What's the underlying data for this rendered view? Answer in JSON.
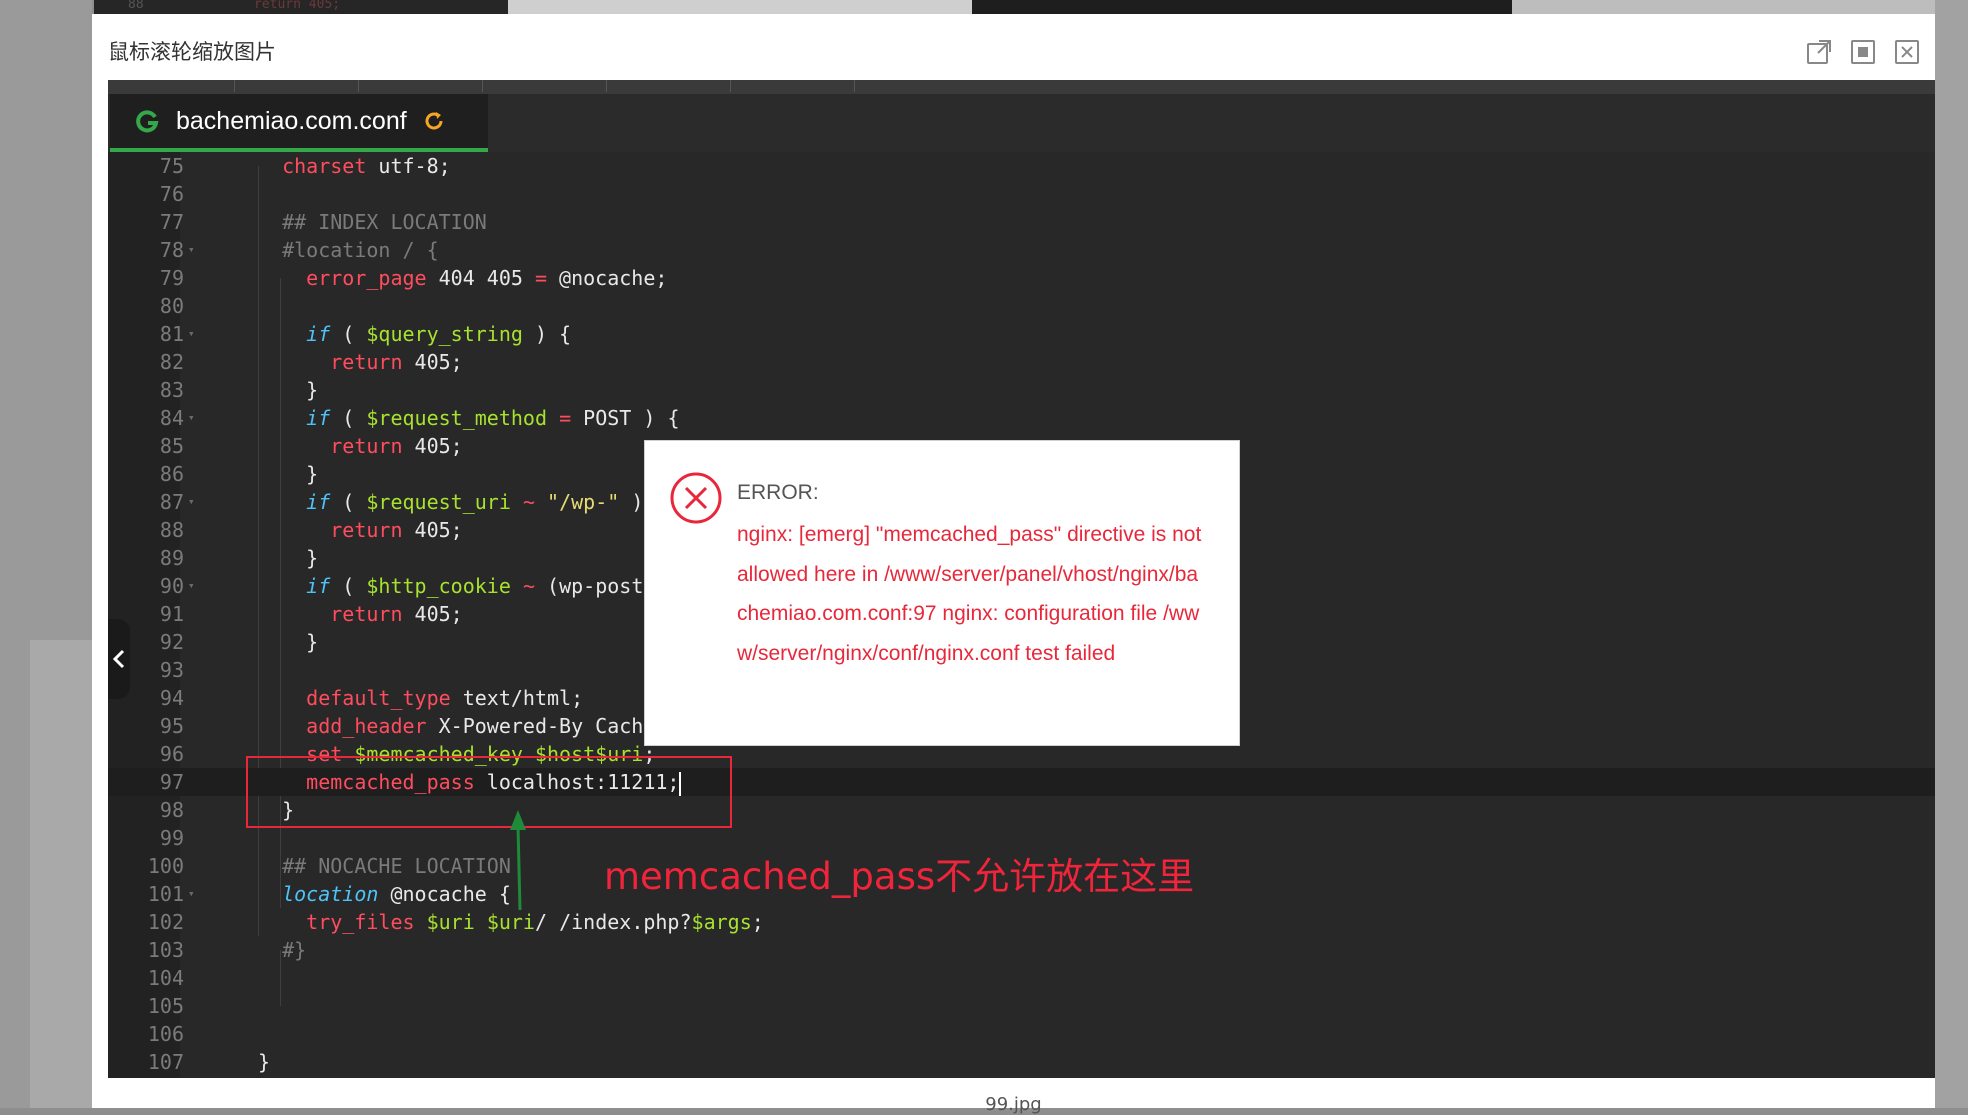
{
  "background": {
    "top_code_line_number": "88",
    "top_code_text": "return 405;"
  },
  "viewer": {
    "title": "鼠标滚轮缩放图片",
    "caption": "99.jpg",
    "icons": [
      "external-link-icon",
      "fit-screen-icon",
      "close-icon"
    ]
  },
  "editor": {
    "tab_name": "bachemiao.com.conf",
    "tab_logo_color": "#35a84a",
    "refresh_icon_color": "#f5a623",
    "lines": [
      {
        "n": "75",
        "text": "  charset utf-8;"
      },
      {
        "n": "76",
        "text": ""
      },
      {
        "n": "77",
        "text": "  ## INDEX LOCATION"
      },
      {
        "n": "78",
        "text": "  #location / {"
      },
      {
        "n": "79",
        "text": "    error_page 404 405 = @nocache;"
      },
      {
        "n": "80",
        "text": ""
      },
      {
        "n": "81",
        "text": "    if ( $query_string ) {"
      },
      {
        "n": "82",
        "text": "      return 405;"
      },
      {
        "n": "83",
        "text": "    }"
      },
      {
        "n": "84",
        "text": "    if ( $request_method = POST ) {"
      },
      {
        "n": "85",
        "text": "      return 405;"
      },
      {
        "n": "86",
        "text": "    }"
      },
      {
        "n": "87",
        "text": "    if ( $request_uri ~ \"/wp-\" )"
      },
      {
        "n": "88",
        "text": "      return 405;"
      },
      {
        "n": "89",
        "text": "    }"
      },
      {
        "n": "90",
        "text": "    if ( $http_cookie ~ (wp-post"
      },
      {
        "n": "91",
        "text": "      return 405;"
      },
      {
        "n": "92",
        "text": "    }"
      },
      {
        "n": "93",
        "text": ""
      },
      {
        "n": "94",
        "text": "    default_type text/html;"
      },
      {
        "n": "95",
        "text": "    add_header X-Powered-By Cachify;"
      },
      {
        "n": "96",
        "text": "    set $memcached_key $host$uri;"
      },
      {
        "n": "97",
        "text": "    memcached_pass localhost:11211;"
      },
      {
        "n": "98",
        "text": "  }"
      },
      {
        "n": "99",
        "text": ""
      },
      {
        "n": "100",
        "text": "  ## NOCACHE LOCATION"
      },
      {
        "n": "101",
        "text": "  location @nocache {"
      },
      {
        "n": "102",
        "text": "    try_files $uri $uri/ /index.php?$args;"
      },
      {
        "n": "103",
        "text": "  #}"
      },
      {
        "n": "104",
        "text": ""
      },
      {
        "n": "105",
        "text": ""
      },
      {
        "n": "106",
        "text": ""
      },
      {
        "n": "107",
        "text": "}"
      }
    ]
  },
  "error_dialog": {
    "title": "ERROR:",
    "message": "nginx: [emerg] \"memcached_pass\" directive is not allowed here in /www/server/panel/vhost/nginx/bachemiao.com.conf:97 nginx: configuration file /www/server/nginx/conf/nginx.conf test failed"
  },
  "annotation": {
    "text": "memcached_pass不允许放在这里",
    "color": "#f0243a"
  }
}
